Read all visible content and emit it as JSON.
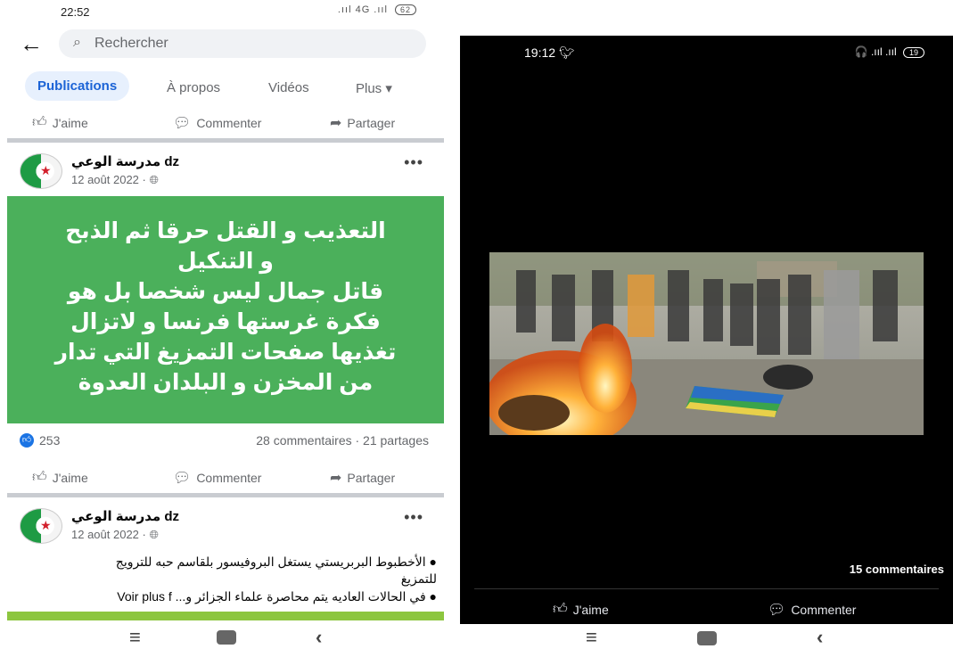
{
  "left": {
    "status": {
      "time": "22:52",
      "right": ".ııl 4G .ııl",
      "battery": "62"
    },
    "search": {
      "placeholder": "Rechercher"
    },
    "tabs": [
      "Publications",
      "À propos",
      "Vidéos",
      "Plus ▾"
    ],
    "action_labels": {
      "like": "J'aime",
      "comment": "Commenter",
      "share": "Partager"
    },
    "post1": {
      "page_name": "مدرسة الوعي dz",
      "date": "12 août 2022 · ",
      "image_text": [
        "التعذيب و القتل حرقا ثم الذبح",
        "و التنكيل",
        "قاتل جمال ليس شخصا بل هو",
        "فكرة غرستها فرنسا و لاتزال",
        "تغذيها صفحات التمزيغ التي تدار",
        "من المخزن و البلدان العدوة"
      ],
      "likes": "253",
      "stats": "28 commentaires · 21 partages"
    },
    "post2": {
      "page_name": "مدرسة الوعي dz",
      "date": "12 août 2022 · ",
      "line1": "● الأخطبوط البربريستي يستغل البروفيسور بلقاسم حبه للترويج",
      "line2": "للتمزيغ",
      "line3": "● في الحالات العاديه يتم محاصرة علماء الجزائر و... Voir plus f"
    }
  },
  "right": {
    "status": {
      "time": "19:12",
      "right": "🎧 .ııl .ııl",
      "battery": "19"
    },
    "comments": "15 commentaires",
    "action_labels": {
      "like": "J'aime",
      "comment": "Commenter"
    }
  },
  "colors": {
    "fb_blue": "#1b74e4",
    "card_green": "#4bb05b",
    "tab_active_bg": "#e7f0fd"
  },
  "icons": [
    "back-arrow-icon",
    "search-icon",
    "like-icon",
    "comment-icon",
    "share-icon",
    "globe-icon",
    "more-icon",
    "menu-icon",
    "home-icon",
    "nav-back-icon",
    "twitter-icon"
  ]
}
